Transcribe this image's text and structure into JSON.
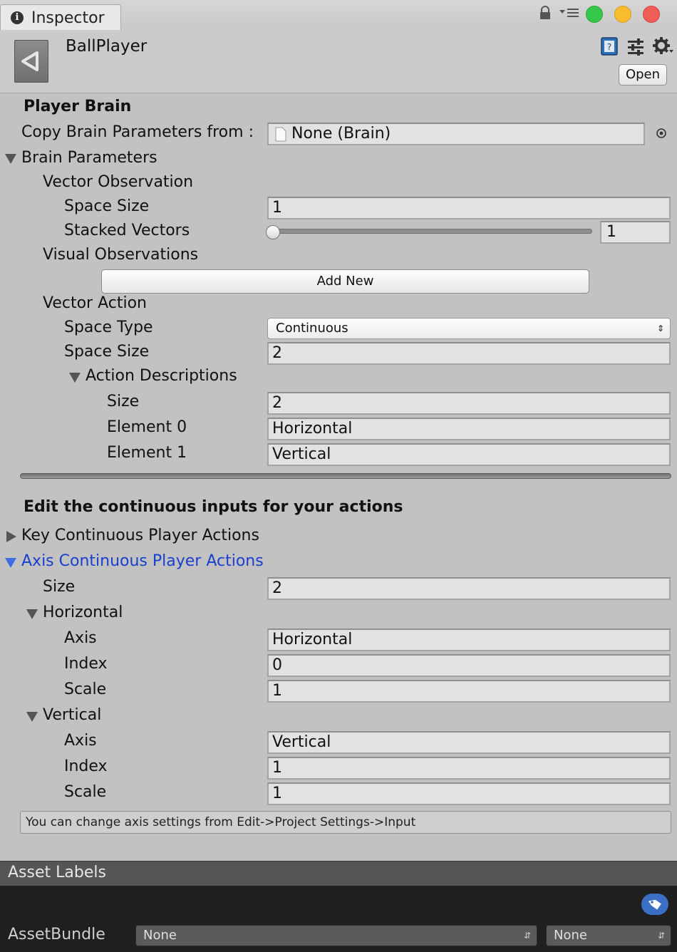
{
  "window": {
    "tab_title": "Inspector",
    "controls": {
      "close": "#ee5e57",
      "minimize": "#f7bd2e",
      "zoom": "#36c84a"
    }
  },
  "header": {
    "asset_name": "BallPlayer",
    "open_button": "Open"
  },
  "player_brain": {
    "heading": "Player Brain",
    "copy_label": "Copy Brain Parameters from :",
    "copy_value": "None (Brain)"
  },
  "brain_parameters": {
    "label": "Brain Parameters",
    "vector_observation": {
      "label": "Vector Observation",
      "space_size_label": "Space Size",
      "space_size_value": "1",
      "stacked_vectors_label": "Stacked Vectors",
      "stacked_vectors_value": "1",
      "stacked_vectors_fraction": 0
    },
    "visual_observations": {
      "label": "Visual Observations",
      "add_new_button": "Add New"
    },
    "vector_action": {
      "label": "Vector Action",
      "space_type_label": "Space Type",
      "space_type_value": "Continuous",
      "space_size_label": "Space Size",
      "space_size_value": "2",
      "action_descriptions": {
        "label": "Action Descriptions",
        "size_label": "Size",
        "size_value": "2",
        "elements": [
          {
            "label": "Element 0",
            "value": "Horizontal"
          },
          {
            "label": "Element 1",
            "value": "Vertical"
          }
        ]
      }
    }
  },
  "continuous_inputs": {
    "heading": "Edit the continuous inputs for your actions",
    "key_actions_label": "Key Continuous Player Actions",
    "axis_actions_label": "Axis Continuous Player Actions",
    "axis_actions_color": "#1a3fcc",
    "size_label": "Size",
    "size_value": "2",
    "entries": [
      {
        "label": "Horizontal",
        "axis_label": "Axis",
        "axis_value": "Horizontal",
        "index_label": "Index",
        "index_value": "0",
        "scale_label": "Scale",
        "scale_value": "1"
      },
      {
        "label": "Vertical",
        "axis_label": "Axis",
        "axis_value": "Vertical",
        "index_label": "Index",
        "index_value": "1",
        "scale_label": "Scale",
        "scale_value": "1"
      }
    ],
    "help_text": "You can change axis settings from Edit->Project Settings->Input"
  },
  "asset_labels": {
    "title": "Asset Labels",
    "assetbundle_label": "AssetBundle",
    "bundle_name": "None",
    "bundle_variant": "None"
  }
}
